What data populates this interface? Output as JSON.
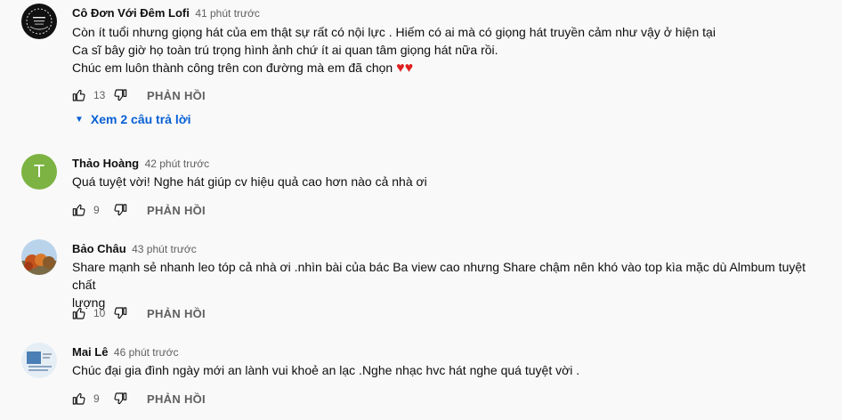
{
  "comments": [
    {
      "author": "Cô Đơn Với Đêm Lofi",
      "time": "41 phút trước",
      "lines": [
        "Còn ít tuổi nhưng giọng hát của em thật sự rất có nội lực . Hiếm có ai mà có giọng hát truyền cảm như vậy ở hiện tại",
        "Ca sĩ bây giờ họ toàn trú trọng hình ảnh chứ ít ai quan tâm giọng hát nữa rồi.",
        "Chúc em luôn thành công trên con đường mà em đã chọn"
      ],
      "hearts": "♥♥",
      "likes": "13",
      "reply_label": "PHẢN HỒI",
      "replies_toggle": "Xem 2 câu trả lời"
    },
    {
      "author": "Thảo Hoàng",
      "time": "42 phút trước",
      "avatar_letter": "T",
      "lines": [
        "Quá tuyệt vời! Nghe hát giúp cv hiệu quả cao hơn nào cả nhà ơi"
      ],
      "likes": "9",
      "reply_label": "PHẢN HỒI"
    },
    {
      "author": "Bảo Châu",
      "time": "43 phút trước",
      "lines": [
        "Share mạnh sẻ nhanh leo tóp cả nhà ơi .nhìn bài của bác Ba view cao nhưng Share chậm nên khó vào top kìa mặc dù Almbum tuyệt chất",
        "lượng"
      ],
      "likes": "10",
      "reply_label": "PHẢN HỒI"
    },
    {
      "author": "Mai Lê",
      "time": "46 phút trước",
      "lines": [
        "Chúc đại gia đình ngày mới an lành vui khoẻ an lạc .Nghe nhạc hvc hát nghe quá tuyệt vời ."
      ],
      "likes": "9",
      "reply_label": "PHẢN HỒI"
    }
  ],
  "icons": {
    "like": "thumbs-up-icon",
    "dislike": "thumbs-down-icon",
    "caret": "caret-down-icon"
  },
  "colors": {
    "text": "#0f0f0f",
    "secondary": "#606060",
    "link": "#065fd4",
    "heart": "#e02020",
    "avatar_t": "#7cb342"
  }
}
